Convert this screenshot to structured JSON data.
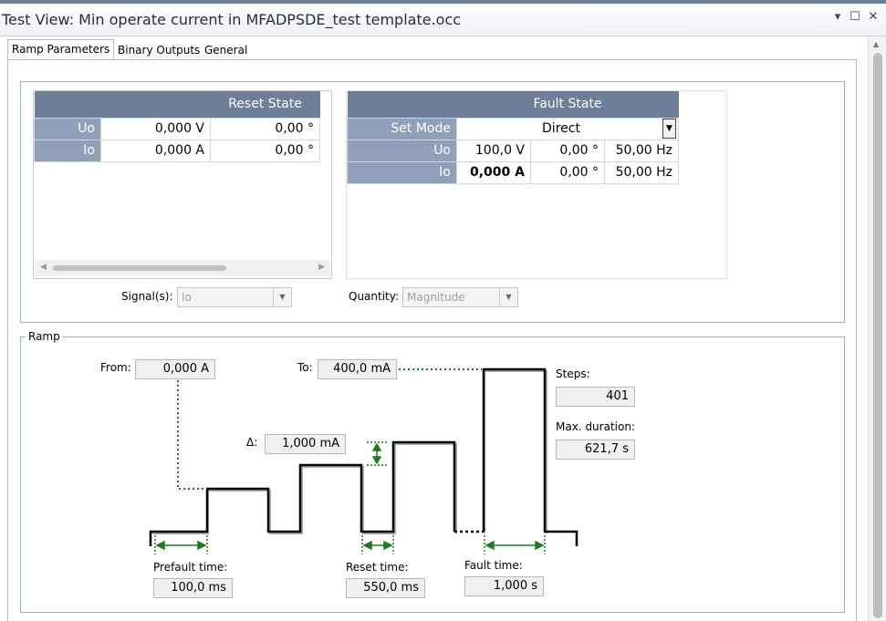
{
  "window": {
    "title": "Test View: Min operate current in MFADPSDE_test template.occ"
  },
  "tabs": [
    {
      "label": "Ramp Parameters",
      "active": true
    },
    {
      "label": "Binary Outputs",
      "active": false
    },
    {
      "label": "General",
      "active": false
    }
  ],
  "reset_state": {
    "header": "Reset State",
    "rows": [
      {
        "name": "Uo",
        "magnitude": "0,000 V",
        "angle": "0,00 °"
      },
      {
        "name": "Io",
        "magnitude": "0,000 A",
        "angle": "0,00 °"
      }
    ]
  },
  "fault_state": {
    "header": "Fault State",
    "set_mode_label": "Set Mode",
    "set_mode_value": "Direct",
    "rows": [
      {
        "name": "Uo",
        "magnitude": "100,0 V",
        "angle": "0,00 °",
        "frequency": "50,00 Hz"
      },
      {
        "name": "Io",
        "magnitude": "0,000 A",
        "angle": "0,00 °",
        "frequency": "50,00 Hz"
      }
    ]
  },
  "signals": {
    "label": "Signal(s):",
    "value": "Io"
  },
  "quantity": {
    "label": "Quantity:",
    "value": "Magnitude"
  },
  "ramp": {
    "group_label": "Ramp",
    "from_label": "From:",
    "from_value": "0,000 A",
    "to_label": "To:",
    "to_value": "400,0 mA",
    "delta_label": "Δ:",
    "delta_value": "1,000 mA",
    "steps_label": "Steps:",
    "steps_value": "401",
    "max_duration_label": "Max. duration:",
    "max_duration_value": "621,7 s",
    "prefault_label": "Prefault time:",
    "prefault_value": "100,0 ms",
    "reset_time_label": "Reset time:",
    "reset_time_value": "550,0 ms",
    "fault_time_label": "Fault time:",
    "fault_time_value": "1,000 s"
  },
  "colors": {
    "accent": "#6d7f98",
    "row_header": "#8fa0b8",
    "arrow": "#1e7a1e"
  }
}
